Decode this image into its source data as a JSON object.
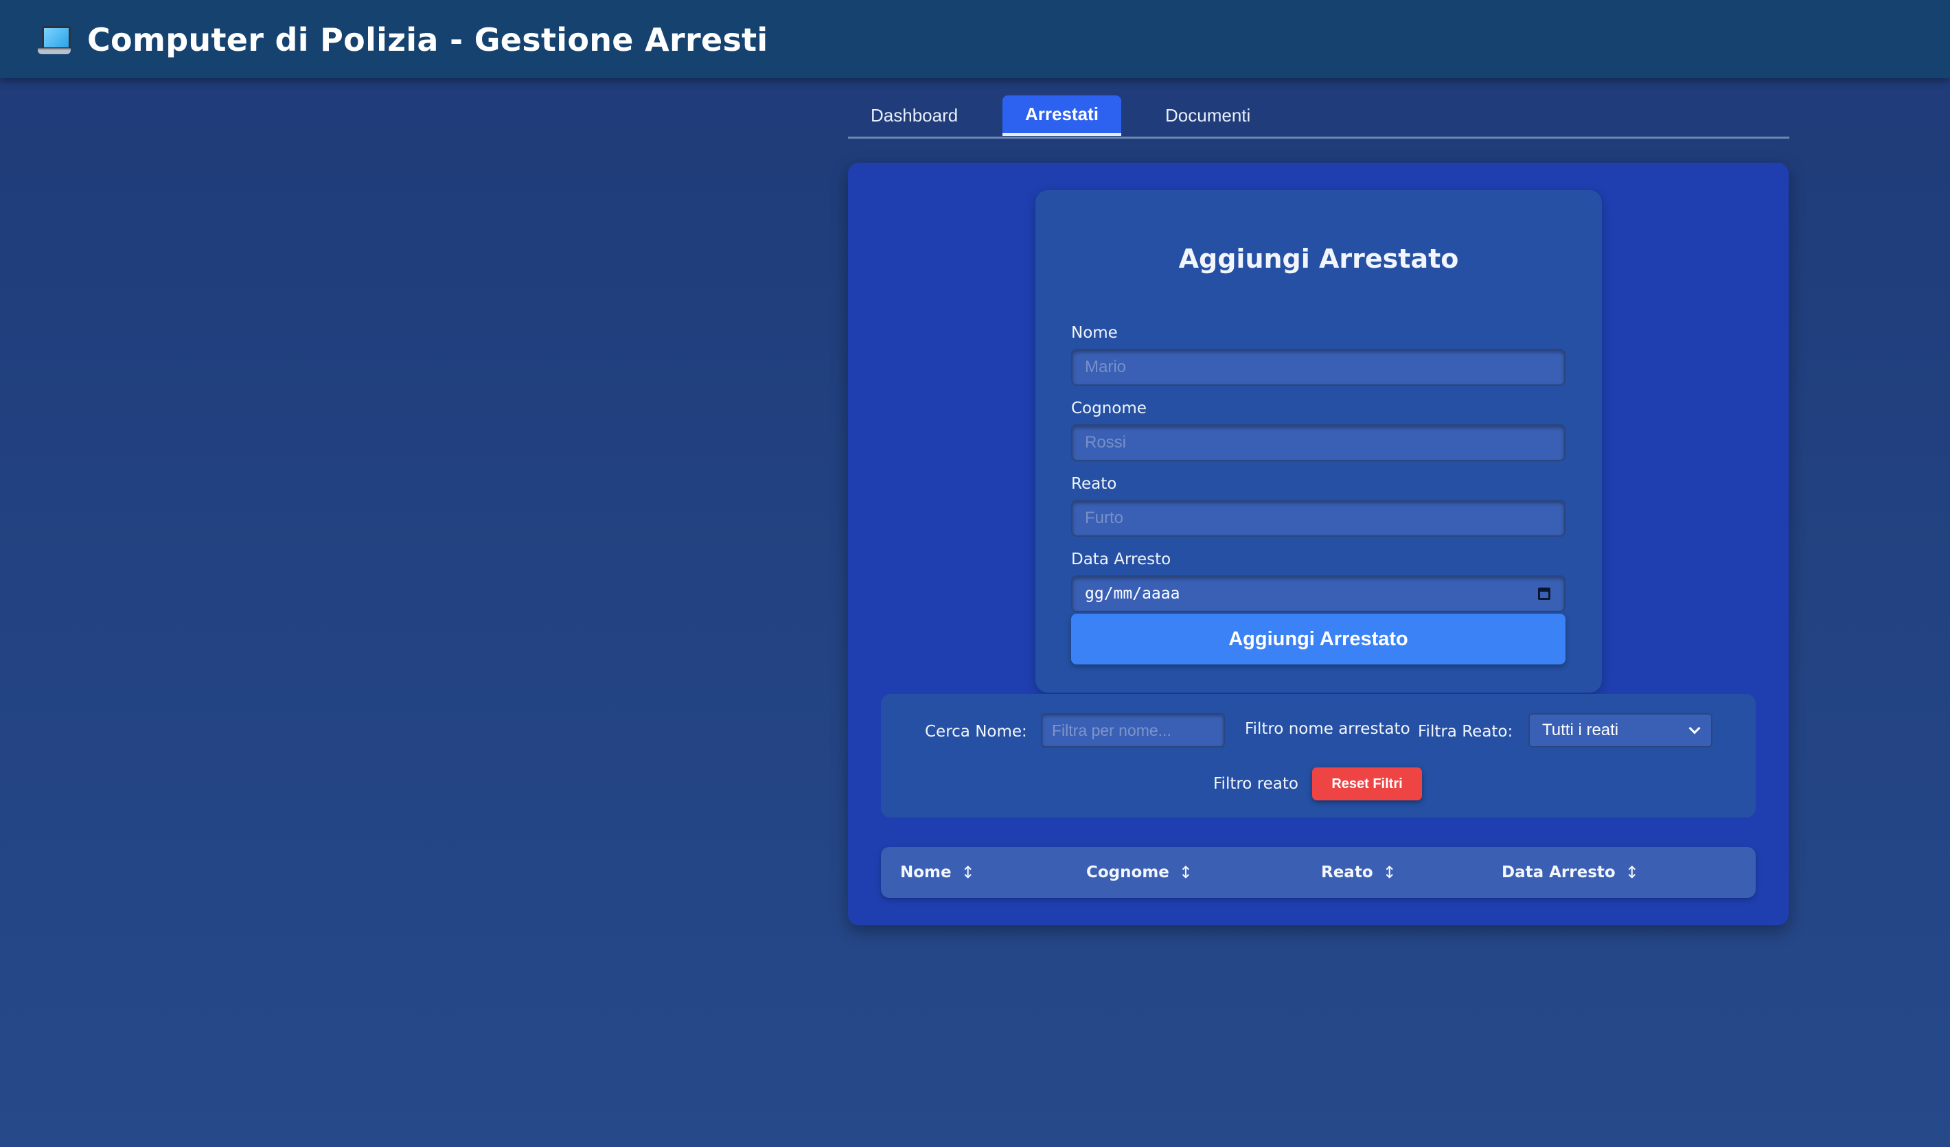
{
  "header": {
    "title": "Computer di Polizia - Gestione Arresti",
    "icon": "laptop-icon"
  },
  "tabs": [
    {
      "label": "Dashboard",
      "active": false
    },
    {
      "label": "Arrestati",
      "active": true
    },
    {
      "label": "Documenti",
      "active": false
    }
  ],
  "form": {
    "title": "Aggiungi Arrestato",
    "fields": [
      {
        "label": "Nome",
        "placeholder": "Mario",
        "value": ""
      },
      {
        "label": "Cognome",
        "placeholder": "Rossi",
        "value": ""
      },
      {
        "label": "Reato",
        "placeholder": "Furto",
        "value": ""
      },
      {
        "label": "Data Arresto",
        "placeholder": "gg/mm/aaaa",
        "value": "",
        "icon": "calendar-icon"
      }
    ],
    "submit_label": "Aggiungi Arrestato"
  },
  "filters": {
    "name_label": "Cerca Nome:",
    "name_placeholder": "Filtra per nome...",
    "name_caption": "Filtro nome arrestato",
    "crime_label": "Filtra Reato:",
    "crime_selected": "Tutti i reati",
    "crime_caption": "Filtro reato",
    "reset_label": "Reset Filtri"
  },
  "table": {
    "columns": [
      {
        "label": "Nome",
        "sort_icon": "↕"
      },
      {
        "label": "Cognome",
        "sort_icon": "↕"
      },
      {
        "label": "Reato",
        "sort_icon": "↕"
      },
      {
        "label": "Data Arresto",
        "sort_icon": "↕"
      }
    ],
    "rows": []
  },
  "colors": {
    "header_bg": "#16426f",
    "panel_bg": "#1f3fb0",
    "card_bg": "#2550a3",
    "active_tab": "#2d62f0",
    "primary_button": "#3b82f6",
    "danger_button": "#ef4444"
  }
}
